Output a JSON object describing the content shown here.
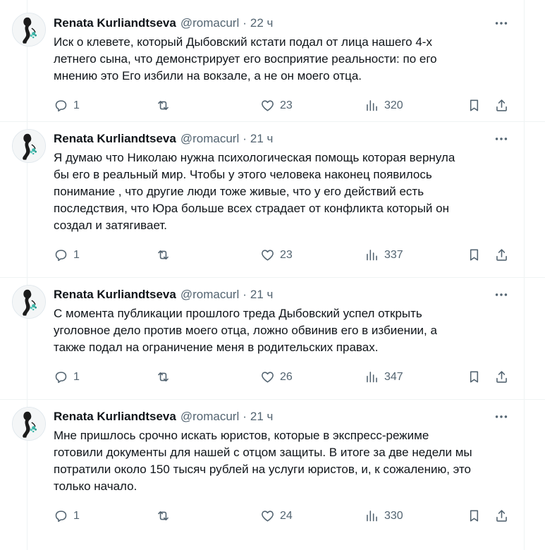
{
  "theme": {
    "text": "#0f1419",
    "muted": "#536471",
    "border": "#eff3f4",
    "avatar_accent": "#3db5a8"
  },
  "icons": {
    "reply": "reply-icon",
    "retweet": "retweet-icon",
    "like": "heart-icon",
    "views": "views-icon",
    "bookmark": "bookmark-icon",
    "share": "share-icon",
    "more": "more-icon"
  },
  "tweets": [
    {
      "name": "Renata Kurliandtseva",
      "handle": "@romacurl",
      "dot": "·",
      "time": "22 ч",
      "lines": [
        "Иск о клевете, который Дыбовский кстати подал от лица нашего 4-х",
        "летнего сына, что демонстрирует его восприятие реальности: по его",
        "мнению это Его избили на вокзале, а не он моего отца."
      ],
      "replies": "1",
      "likes": "23",
      "views": "320"
    },
    {
      "name": "Renata Kurliandtseva",
      "handle": "@romacurl",
      "dot": "·",
      "time": "21 ч",
      "lines": [
        "Я думаю что Николаю нужна психологическая помощь которая вернула",
        "бы его в реальный мир. Чтобы у этого человека наконец появилось",
        "понимание , что другие люди тоже живые, что у его действий есть",
        "последствия, что Юра больше всех страдает от конфликта который он",
        "создал и затягивает."
      ],
      "replies": "1",
      "likes": "23",
      "views": "337"
    },
    {
      "name": "Renata Kurliandtseva",
      "handle": "@romacurl",
      "dot": "·",
      "time": "21 ч",
      "lines": [
        "С момента публикации прошлого треда Дыбовский успел открыть",
        "уголовное дело против моего отца, ложно обвинив его в избиении, а",
        "также подал на ограничение меня в родительских правах."
      ],
      "replies": "1",
      "likes": "26",
      "views": "347"
    },
    {
      "name": "Renata Kurliandtseva",
      "handle": "@romacurl",
      "dot": "·",
      "time": "21 ч",
      "lines": [
        "Мне пришлось срочно искать юристов, которые в экспресс-режиме",
        "готовили документы для нашей с отцом защиты. В итоге за две недели мы",
        "потратили около 150 тысяч рублей на услуги юристов, и, к сожалению, это",
        "только начало."
      ],
      "replies": "1",
      "likes": "24",
      "views": "330"
    }
  ]
}
